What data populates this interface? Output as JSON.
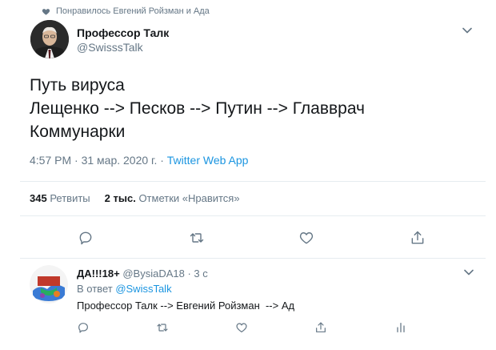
{
  "social_context": {
    "text": "Понравилось Евгений Ройзман и Ада",
    "icon": "heart-icon"
  },
  "tweet": {
    "author_name": "Профессор Талк",
    "author_handle": "@SwisssTalk",
    "text": "Путь вируса\nЛещенко --> Песков --> Путин --> Главврач\nКоммунарки",
    "time": "4:57 PM · 31 мар. 2020 г. · ",
    "source": "Twitter Web App",
    "retweets_count": "345",
    "retweets_label": "Ретвиты",
    "likes_count": "2 тыс.",
    "likes_label": "Отметки «Нравится»",
    "action_icons": [
      "reply-icon",
      "retweet-icon",
      "like-icon",
      "share-icon"
    ]
  },
  "reply": {
    "author_name": "ДА!!!18+",
    "author_handle": "@BysiaDA18",
    "time": " · 3 с",
    "replying_prefix": "В ответ ",
    "replying_to": "@SwissTalk",
    "text": "Профессор Талк --> Евгений Ройзман  --> Ад",
    "action_icons": [
      "reply-icon",
      "retweet-icon",
      "like-icon",
      "share-icon",
      "analytics-icon"
    ]
  },
  "colors": {
    "link": "#1b95e0",
    "secondary_text": "#657786",
    "divider": "#e6ecf0",
    "icon": "#657786"
  }
}
